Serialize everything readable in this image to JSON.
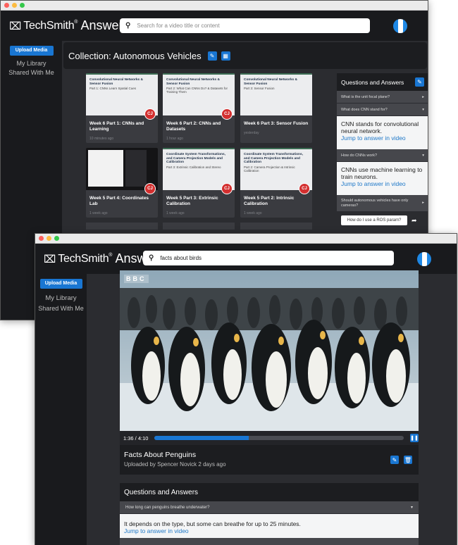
{
  "colors": {
    "accent": "#1976d2",
    "appbar": "#191a1d",
    "avatar": "#d32f2f"
  },
  "back": {
    "brand": {
      "mark": "⌧",
      "name": "TechSmith",
      "reg": "®",
      "product": "Answers"
    },
    "search": {
      "placeholder": "Search for a video title or content"
    },
    "sidebar": {
      "upload": "Upload Media",
      "library": "My Library",
      "shared": "Shared With Me"
    },
    "collection_title": "Collection: Autonomous Vehicles",
    "cards": [
      {
        "thumb_title": "Convolutional Neural Networks & Sensor Fusion",
        "thumb_sub": "Part 1: CNNs Learn Spatial Cues",
        "title": "Week 6 Part 1: CNNs and Learning",
        "date": "10 minutes ago",
        "avatar": "CJ"
      },
      {
        "thumb_title": "Convolutional Neural Networks & Sensor Fusion",
        "thumb_sub": "Part 2: What Can CNNs Do? & Datasets for Training Them",
        "title": "Week 6 Part 2: CNNs and Datasets",
        "date": "1 hour ago",
        "avatar": "CJ"
      },
      {
        "thumb_title": "Convolutional Neural Networks & Sensor Fusion",
        "thumb_sub": "Part 3: Sensor Fusion",
        "title": "Week 6 Part 3: Sensor Fusion",
        "date": "yesterday",
        "avatar": ""
      },
      {
        "thumb_title": "",
        "thumb_sub": "",
        "title": "Week 5 Part 4: Coordinates Lab",
        "date": "1 week ago",
        "avatar": "CJ"
      },
      {
        "thumb_title": "Coordinate System Transformations, and Camera Projection Models and Calibration",
        "thumb_sub": "Part 3: Extrinsic Calibration and Stereo",
        "title": "Week 5 Part 3: Extrinsic Calibration",
        "date": "1 week ago",
        "avatar": "CJ"
      },
      {
        "thumb_title": "Coordinate System Transformations, and Camera Projection Models and Calibration",
        "thumb_sub": "Part 2: Camera Projection & Intrinsic Calibration",
        "title": "Week 5 Part 2: Intrinsic Calibration",
        "date": "1 week ago",
        "avatar": "CJ"
      }
    ],
    "qa": {
      "title": "Questions and Answers",
      "items": [
        {
          "q": "What is the unit focal plane?",
          "answer": "",
          "link": ""
        },
        {
          "q": "What does CNN stand for?",
          "answer": "CNN stands for convolutional neural network.",
          "link": "Jump to answer in video"
        },
        {
          "q": "How do CNNs work?",
          "answer": "CNNs use machine learning to train neurons.",
          "link": "Jump to answer in video"
        },
        {
          "q": "Should autonomous vehicles have only cameras?",
          "answer": "",
          "link": ""
        }
      ],
      "ask_value": "How do I use a ROS param?"
    }
  },
  "front": {
    "brand": {
      "mark": "⌧",
      "name": "TechSmith",
      "reg": "®",
      "product": "Answers"
    },
    "search": {
      "value": "facts about birds"
    },
    "sidebar": {
      "upload": "Upload Media",
      "library": "My Library",
      "shared": "Shared With Me"
    },
    "video": {
      "watermark": "BBC",
      "time": "1:36 / 4:10",
      "progress": 0.38,
      "title": "Facts About Penguins",
      "meta": "Uploaded by Spencer Novick 2 days ago"
    },
    "qa": {
      "title": "Questions and Answers",
      "question": "How long can penguins breathe underwater?",
      "answer": "It depends on the type, but some can breathe for up to 25 minutes.",
      "link": "Jump to answer in video"
    }
  }
}
